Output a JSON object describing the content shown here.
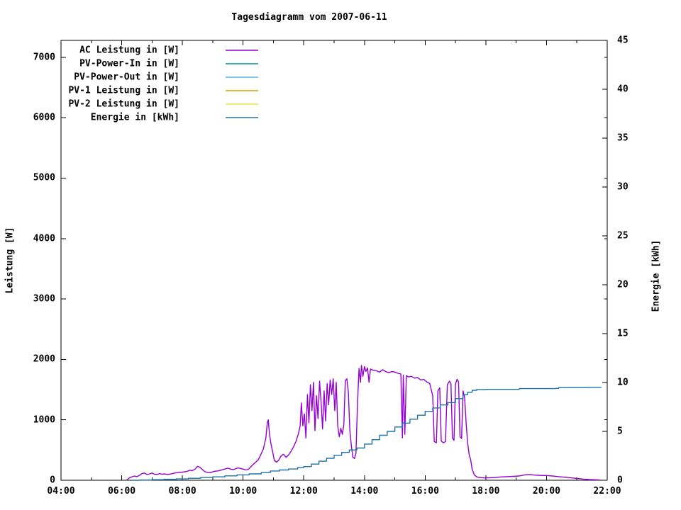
{
  "title": "Tagesdiagramm vom 2007-06-11",
  "background": "#ffffff",
  "axis_color": "#000000",
  "chart_data": {
    "type": "line",
    "title": "Tagesdiagramm vom 2007-06-11",
    "xlabel": "",
    "ylabel": "Leistung [W]",
    "y2label": "Energie [kWh]",
    "grid": false,
    "legend_position": "top-left-inside",
    "xlim_hours": [
      4,
      22
    ],
    "x_major_ticks": [
      {
        "hour": 4,
        "label": "04:00"
      },
      {
        "hour": 6,
        "label": "06:00"
      },
      {
        "hour": 8,
        "label": "08:00"
      },
      {
        "hour": 10,
        "label": "10:00"
      },
      {
        "hour": 12,
        "label": "12:00"
      },
      {
        "hour": 14,
        "label": "14:00"
      },
      {
        "hour": 16,
        "label": "16:00"
      },
      {
        "hour": 18,
        "label": "18:00"
      },
      {
        "hour": 20,
        "label": "20:00"
      },
      {
        "hour": 22,
        "label": "22:00"
      }
    ],
    "x_minor_ticks_hours": [
      5,
      7,
      9,
      11,
      13,
      15,
      17,
      19,
      21
    ],
    "ylim": [
      0,
      7280
    ],
    "y_ticks": [
      0,
      1000,
      2000,
      3000,
      4000,
      5000,
      6000,
      7000
    ],
    "y2lim": [
      0,
      45
    ],
    "y2_ticks": [
      0,
      5,
      10,
      15,
      20,
      25,
      30,
      35,
      40,
      45
    ],
    "legend": [
      {
        "label": "AC Leistung in [W]",
        "color": "#9400D3"
      },
      {
        "label": "PV-Power-In in [W]",
        "color": "#009090"
      },
      {
        "label": "PV-Power-Out in [W]",
        "color": "#56B4E9"
      },
      {
        "label": "PV-1 Leistung in [W]",
        "color": "#DFA000"
      },
      {
        "label": "PV-2 Leistung in [W]",
        "color": "#EDE13F"
      },
      {
        "label": "Energie in [kWh]",
        "color": "#1E73AA"
      }
    ],
    "series": [
      {
        "name": "AC Leistung in [W]",
        "axis": "y1",
        "color": "#9400D3",
        "mode": "line",
        "points": [
          [
            6.17,
            5
          ],
          [
            6.25,
            40
          ],
          [
            6.33,
            55
          ],
          [
            6.42,
            70
          ],
          [
            6.5,
            60
          ],
          [
            6.58,
            80
          ],
          [
            6.67,
            110
          ],
          [
            6.75,
            120
          ],
          [
            6.83,
            95
          ],
          [
            6.92,
            105
          ],
          [
            7.0,
            120
          ],
          [
            7.08,
            100
          ],
          [
            7.17,
            95
          ],
          [
            7.25,
            110
          ],
          [
            7.33,
            100
          ],
          [
            7.42,
            105
          ],
          [
            7.5,
            95
          ],
          [
            7.58,
            100
          ],
          [
            7.67,
            110
          ],
          [
            7.75,
            120
          ],
          [
            7.83,
            125
          ],
          [
            7.92,
            130
          ],
          [
            8.0,
            135
          ],
          [
            8.08,
            140
          ],
          [
            8.17,
            150
          ],
          [
            8.25,
            165
          ],
          [
            8.33,
            160
          ],
          [
            8.42,
            185
          ],
          [
            8.5,
            230
          ],
          [
            8.58,
            215
          ],
          [
            8.67,
            170
          ],
          [
            8.75,
            140
          ],
          [
            8.83,
            130
          ],
          [
            8.92,
            125
          ],
          [
            9.0,
            140
          ],
          [
            9.08,
            150
          ],
          [
            9.17,
            155
          ],
          [
            9.25,
            165
          ],
          [
            9.33,
            175
          ],
          [
            9.42,
            190
          ],
          [
            9.5,
            200
          ],
          [
            9.58,
            185
          ],
          [
            9.67,
            175
          ],
          [
            9.75,
            190
          ],
          [
            9.83,
            205
          ],
          [
            9.92,
            195
          ],
          [
            10.0,
            185
          ],
          [
            10.08,
            170
          ],
          [
            10.17,
            180
          ],
          [
            10.25,
            220
          ],
          [
            10.33,
            260
          ],
          [
            10.42,
            300
          ],
          [
            10.5,
            340
          ],
          [
            10.58,
            420
          ],
          [
            10.67,
            520
          ],
          [
            10.75,
            700
          ],
          [
            10.8,
            960
          ],
          [
            10.83,
            1000
          ],
          [
            10.87,
            760
          ],
          [
            10.92,
            600
          ],
          [
            10.97,
            480
          ],
          [
            11.03,
            330
          ],
          [
            11.1,
            300
          ],
          [
            11.17,
            330
          ],
          [
            11.25,
            400
          ],
          [
            11.33,
            430
          ],
          [
            11.42,
            380
          ],
          [
            11.5,
            420
          ],
          [
            11.58,
            480
          ],
          [
            11.67,
            560
          ],
          [
            11.75,
            650
          ],
          [
            11.83,
            780
          ],
          [
            11.88,
            900
          ],
          [
            11.92,
            1280
          ],
          [
            11.97,
            900
          ],
          [
            12.02,
            1100
          ],
          [
            12.07,
            700
          ],
          [
            12.12,
            1420
          ],
          [
            12.17,
            950
          ],
          [
            12.22,
            1580
          ],
          [
            12.27,
            1150
          ],
          [
            12.32,
            1620
          ],
          [
            12.37,
            820
          ],
          [
            12.42,
            1400
          ],
          [
            12.47,
            1020
          ],
          [
            12.52,
            1640
          ],
          [
            12.57,
            1300
          ],
          [
            12.62,
            850
          ],
          [
            12.67,
            1480
          ],
          [
            12.72,
            980
          ],
          [
            12.77,
            1600
          ],
          [
            12.82,
            1250
          ],
          [
            12.87,
            1660
          ],
          [
            12.92,
            1420
          ],
          [
            12.97,
            1680
          ],
          [
            13.02,
            1150
          ],
          [
            13.07,
            1620
          ],
          [
            13.12,
            900
          ],
          [
            13.17,
            720
          ],
          [
            13.22,
            860
          ],
          [
            13.27,
            760
          ],
          [
            13.32,
            920
          ],
          [
            13.37,
            1650
          ],
          [
            13.42,
            1680
          ],
          [
            13.47,
            1450
          ],
          [
            13.52,
            820
          ],
          [
            13.57,
            560
          ],
          [
            13.62,
            380
          ],
          [
            13.67,
            360
          ],
          [
            13.72,
            450
          ],
          [
            13.77,
            1250
          ],
          [
            13.82,
            1850
          ],
          [
            13.87,
            1620
          ],
          [
            13.9,
            1900
          ],
          [
            13.95,
            1720
          ],
          [
            14.0,
            1880
          ],
          [
            14.05,
            1800
          ],
          [
            14.1,
            1860
          ],
          [
            14.15,
            1620
          ],
          [
            14.2,
            1840
          ],
          [
            14.3,
            1820
          ],
          [
            14.4,
            1810
          ],
          [
            14.5,
            1790
          ],
          [
            14.6,
            1830
          ],
          [
            14.7,
            1800
          ],
          [
            14.8,
            1780
          ],
          [
            14.9,
            1800
          ],
          [
            15.0,
            1790
          ],
          [
            15.1,
            1770
          ],
          [
            15.2,
            1760
          ],
          [
            15.25,
            700
          ],
          [
            15.28,
            1740
          ],
          [
            15.33,
            760
          ],
          [
            15.38,
            1730
          ],
          [
            15.45,
            1710
          ],
          [
            15.55,
            1720
          ],
          [
            15.65,
            1690
          ],
          [
            15.75,
            1700
          ],
          [
            15.85,
            1660
          ],
          [
            15.95,
            1670
          ],
          [
            16.05,
            1630
          ],
          [
            16.15,
            1600
          ],
          [
            16.25,
            1400
          ],
          [
            16.3,
            640
          ],
          [
            16.37,
            620
          ],
          [
            16.42,
            1480
          ],
          [
            16.48,
            1530
          ],
          [
            16.53,
            650
          ],
          [
            16.6,
            620
          ],
          [
            16.67,
            640
          ],
          [
            16.73,
            1580
          ],
          [
            16.8,
            1640
          ],
          [
            16.85,
            1600
          ],
          [
            16.9,
            700
          ],
          [
            16.95,
            660
          ],
          [
            17.0,
            1590
          ],
          [
            17.05,
            1670
          ],
          [
            17.1,
            1630
          ],
          [
            17.15,
            720
          ],
          [
            17.2,
            690
          ],
          [
            17.25,
            1480
          ],
          [
            17.3,
            1380
          ],
          [
            17.35,
            950
          ],
          [
            17.4,
            620
          ],
          [
            17.45,
            420
          ],
          [
            17.5,
            340
          ],
          [
            17.55,
            180
          ],
          [
            17.62,
            90
          ],
          [
            17.7,
            55
          ],
          [
            17.8,
            45
          ],
          [
            17.95,
            40
          ],
          [
            18.1,
            40
          ],
          [
            18.3,
            45
          ],
          [
            18.5,
            55
          ],
          [
            18.7,
            60
          ],
          [
            18.9,
            65
          ],
          [
            19.1,
            70
          ],
          [
            19.3,
            90
          ],
          [
            19.45,
            95
          ],
          [
            19.6,
            85
          ],
          [
            19.8,
            80
          ],
          [
            20.0,
            78
          ],
          [
            20.2,
            70
          ],
          [
            20.4,
            60
          ],
          [
            20.6,
            50
          ],
          [
            20.8,
            40
          ],
          [
            21.0,
            30
          ],
          [
            21.2,
            20
          ],
          [
            21.4,
            12
          ],
          [
            21.6,
            8
          ],
          [
            21.75,
            5
          ]
        ]
      },
      {
        "name": "Energie in [kWh]",
        "axis": "y2",
        "color": "#1E73AA",
        "mode": "steps",
        "points": [
          [
            6.3,
            0
          ],
          [
            6.6,
            0.02
          ],
          [
            7.0,
            0.06
          ],
          [
            7.4,
            0.1
          ],
          [
            7.8,
            0.14
          ],
          [
            8.2,
            0.2
          ],
          [
            8.6,
            0.28
          ],
          [
            9.0,
            0.35
          ],
          [
            9.4,
            0.45
          ],
          [
            9.8,
            0.55
          ],
          [
            10.2,
            0.65
          ],
          [
            10.6,
            0.78
          ],
          [
            10.9,
            0.95
          ],
          [
            11.2,
            1.05
          ],
          [
            11.5,
            1.15
          ],
          [
            11.8,
            1.3
          ],
          [
            12.0,
            1.4
          ],
          [
            12.25,
            1.65
          ],
          [
            12.5,
            1.95
          ],
          [
            12.75,
            2.25
          ],
          [
            13.0,
            2.55
          ],
          [
            13.25,
            2.85
          ],
          [
            13.5,
            3.1
          ],
          [
            13.75,
            3.3
          ],
          [
            14.0,
            3.7
          ],
          [
            14.25,
            4.15
          ],
          [
            14.5,
            4.6
          ],
          [
            14.75,
            5.0
          ],
          [
            15.0,
            5.45
          ],
          [
            15.25,
            5.85
          ],
          [
            15.5,
            6.25
          ],
          [
            15.75,
            6.65
          ],
          [
            16.0,
            7.05
          ],
          [
            16.25,
            7.4
          ],
          [
            16.5,
            7.7
          ],
          [
            16.75,
            7.95
          ],
          [
            17.0,
            8.35
          ],
          [
            17.25,
            8.75
          ],
          [
            17.4,
            9.0
          ],
          [
            17.55,
            9.2
          ],
          [
            17.7,
            9.28
          ],
          [
            18.0,
            9.3
          ],
          [
            19.0,
            9.3
          ],
          [
            19.1,
            9.38
          ],
          [
            20.3,
            9.4
          ],
          [
            20.4,
            9.48
          ],
          [
            21.3,
            9.5
          ],
          [
            21.8,
            9.52
          ]
        ]
      }
    ]
  }
}
